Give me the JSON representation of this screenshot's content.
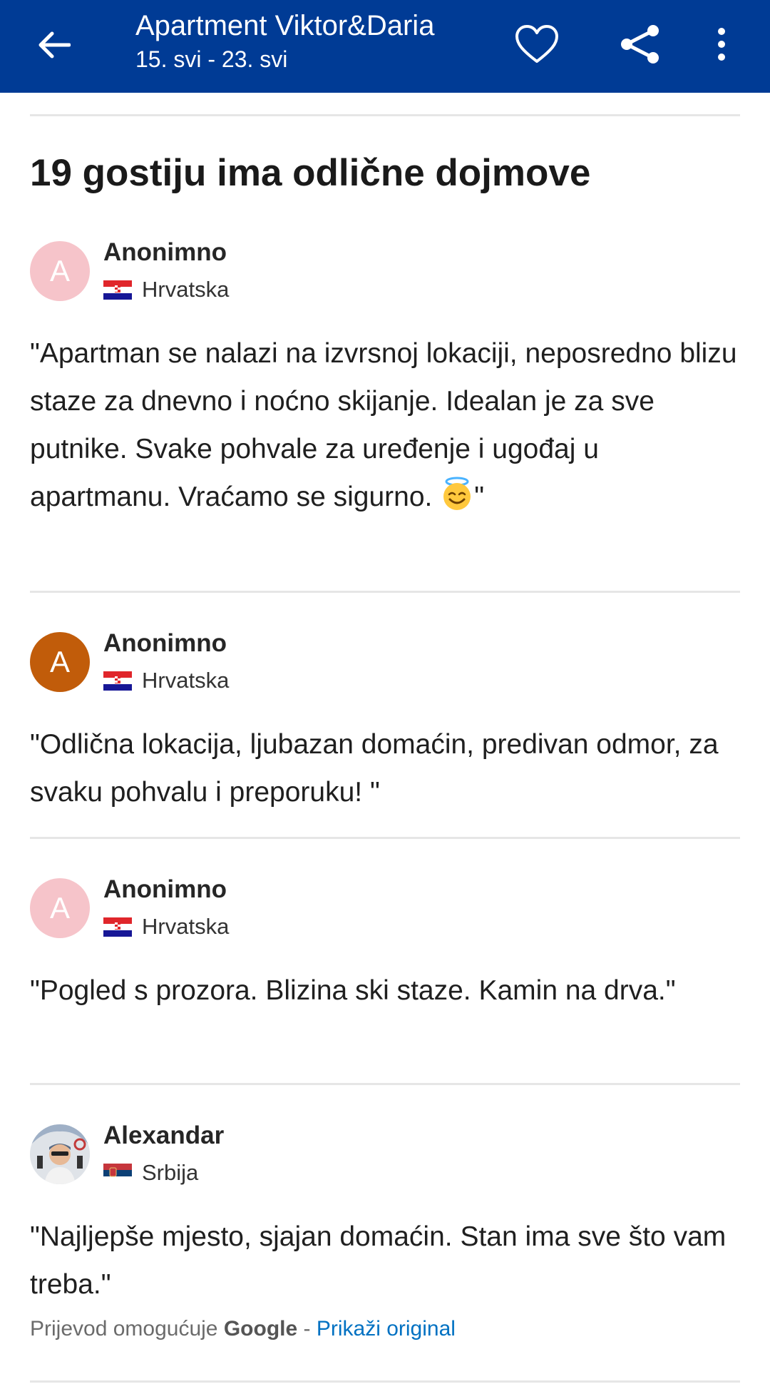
{
  "appbar": {
    "title": "Apartment Viktor&Daria",
    "dates": "15. svi - 23. svi",
    "background_color": "#003b95",
    "icons": [
      "arrow-left-icon",
      "heart-icon",
      "share-icon",
      "more-vertical-icon"
    ]
  },
  "section": {
    "title": "19 gostiju ima odlične dojmove"
  },
  "reviews": [
    {
      "initial": "A",
      "name": "Anonimno",
      "country": "Hrvatska",
      "flag": "croatia",
      "avatar_color": "#f6c4ca",
      "text": "\"Apartman se nalazi na izvrsnoj lokaciji, neposredno blizu staze za dnevno i noćno skijanje. Idealan je za sve putnike. Svake pohvale za uređenje i ugođaj u apartmanu. Vraćamo se sigurno. ",
      "text_end": "\"",
      "emoji": "smiling-face-with-halo-emoji"
    },
    {
      "initial": "A",
      "name": "Anonimno",
      "country": "Hrvatska",
      "flag": "croatia",
      "avatar_color": "#c15c0a",
      "text": "\"Odlična lokacija, ljubazan domaćin, predivan odmor, za svaku pohvalu i preporuku! \""
    },
    {
      "initial": "A",
      "name": "Anonimno",
      "country": "Hrvatska",
      "flag": "croatia",
      "avatar_color": "#f6c4ca",
      "text": "\"Pogled s prozora. Blizina ski staze. Kamin na drva.\""
    },
    {
      "name": "Alexandar",
      "country": "Srbija",
      "flag": "serbia",
      "avatar": "user-photo-avatar",
      "text": "\"Najljepše mjesto, sjajan domaćin. Stan ima sve što vam treba.\""
    }
  ],
  "translation": {
    "prefix": "Prijevod omogućuje ",
    "provider": "Google",
    "separator": " - ",
    "link": "Prikaži original"
  }
}
